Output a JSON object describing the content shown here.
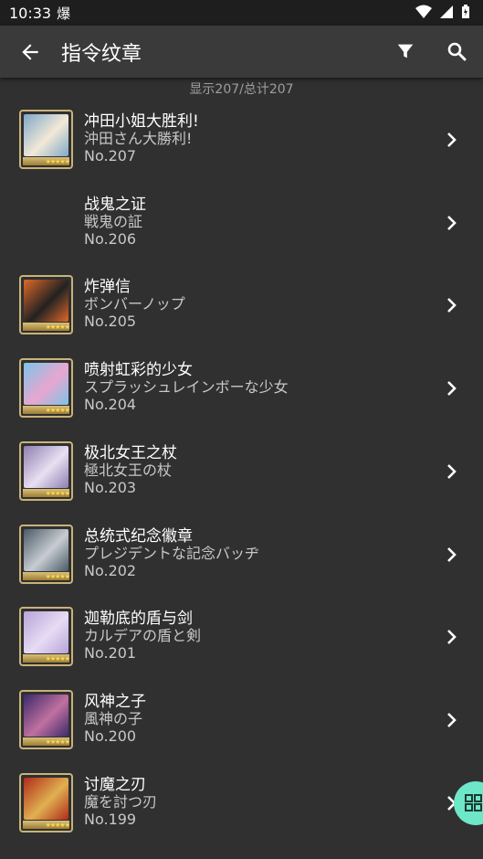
{
  "status_bar": {
    "time": "10:33",
    "app_icon": "爆"
  },
  "app_bar": {
    "title": "指令纹章"
  },
  "summary": "显示207/总计207",
  "items": [
    {
      "cn": "冲田小姐大胜利!",
      "jp": "沖田さん大勝利!",
      "no": "No.207",
      "has_thumb": true,
      "colors": [
        "#7fa8c9",
        "#f2e8d6"
      ]
    },
    {
      "cn": "战鬼之证",
      "jp": "戦鬼の証",
      "no": "No.206",
      "has_thumb": false,
      "colors": [
        "#303030",
        "#303030"
      ]
    },
    {
      "cn": "炸弹信",
      "jp": "ボンバーノップ",
      "no": "No.205",
      "has_thumb": true,
      "colors": [
        "#e0682a",
        "#222222"
      ]
    },
    {
      "cn": "喷射虹彩的少女",
      "jp": "スプラッシュレインボーな少女",
      "no": "No.204",
      "has_thumb": true,
      "colors": [
        "#7bc4e8",
        "#e8a6d0"
      ]
    },
    {
      "cn": "极北女王之杖",
      "jp": "極北女王の杖",
      "no": "No.203",
      "has_thumb": true,
      "colors": [
        "#8d7fb0",
        "#e8e0f2"
      ]
    },
    {
      "cn": "总统式纪念徽章",
      "jp": "プレジデントな記念バッヂ",
      "no": "No.202",
      "has_thumb": true,
      "colors": [
        "#4a5a66",
        "#c7ccd2"
      ]
    },
    {
      "cn": "迦勒底的盾与剑",
      "jp": "カルデアの盾と剣",
      "no": "No.201",
      "has_thumb": true,
      "colors": [
        "#b8a2d8",
        "#e6dcf4"
      ]
    },
    {
      "cn": "风神之子",
      "jp": "風神の子",
      "no": "No.200",
      "has_thumb": true,
      "colors": [
        "#3a2a6a",
        "#c070a0"
      ]
    },
    {
      "cn": "讨魔之刃",
      "jp": "魔を討つ刃",
      "no": "No.199",
      "has_thumb": true,
      "colors": [
        "#b02a1a",
        "#e0b050"
      ]
    }
  ]
}
